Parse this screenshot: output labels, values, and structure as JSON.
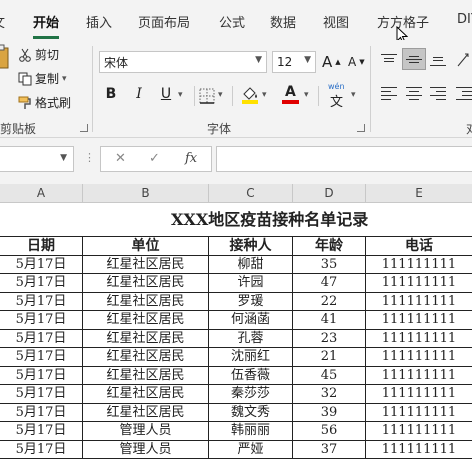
{
  "ribbon_tabs": [
    "开始",
    "插入",
    "页面布局",
    "公式",
    "数据",
    "视图",
    "方方格子",
    "DIY"
  ],
  "ribbon_partial_tab": "文",
  "clipboard": {
    "cut": "剪切",
    "copy": "复制",
    "format_painter": "格式刷",
    "group_label": "剪贴板"
  },
  "font": {
    "name": "宋体",
    "size": "12",
    "bold": "B",
    "italic": "I",
    "underline": "U",
    "grow": "A",
    "shrink": "A",
    "phonetic": "wén",
    "phonetic_char": "文",
    "group_label": "字体",
    "fill_color": "#ffe100",
    "font_color": "#e00000"
  },
  "alignment": {
    "group_label": "对"
  },
  "formula_bar": {
    "cancel": "✕",
    "enter": "✓",
    "fx": "fx",
    "value": ""
  },
  "columns": [
    "A",
    "B",
    "C",
    "D",
    "E"
  ],
  "sheet": {
    "title": "XXX地区疫苗接种名单记录",
    "headers": [
      "日期",
      "单位",
      "接种人",
      "年龄",
      "电话"
    ],
    "rows": [
      [
        "5月17日",
        "红星社区居民",
        "柳甜",
        "35",
        "111111111"
      ],
      [
        "5月17日",
        "红星社区居民",
        "许园",
        "47",
        "111111111"
      ],
      [
        "5月17日",
        "红星社区居民",
        "罗瑗",
        "22",
        "111111111"
      ],
      [
        "5月17日",
        "红星社区居民",
        "何涵菡",
        "41",
        "111111111"
      ],
      [
        "5月17日",
        "红星社区居民",
        "孔蓉",
        "23",
        "111111111"
      ],
      [
        "5月17日",
        "红星社区居民",
        "沈丽红",
        "21",
        "111111111"
      ],
      [
        "5月17日",
        "红星社区居民",
        "伍香薇",
        "45",
        "111111111"
      ],
      [
        "5月17日",
        "红星社区居民",
        "秦莎莎",
        "32",
        "111111111"
      ],
      [
        "5月17日",
        "红星社区居民",
        "魏文秀",
        "39",
        "111111111"
      ],
      [
        "5月17日",
        "管理人员",
        "韩丽丽",
        "56",
        "111111111"
      ],
      [
        "5月17日",
        "管理人员",
        "严娅",
        "37",
        "111111111"
      ]
    ]
  }
}
